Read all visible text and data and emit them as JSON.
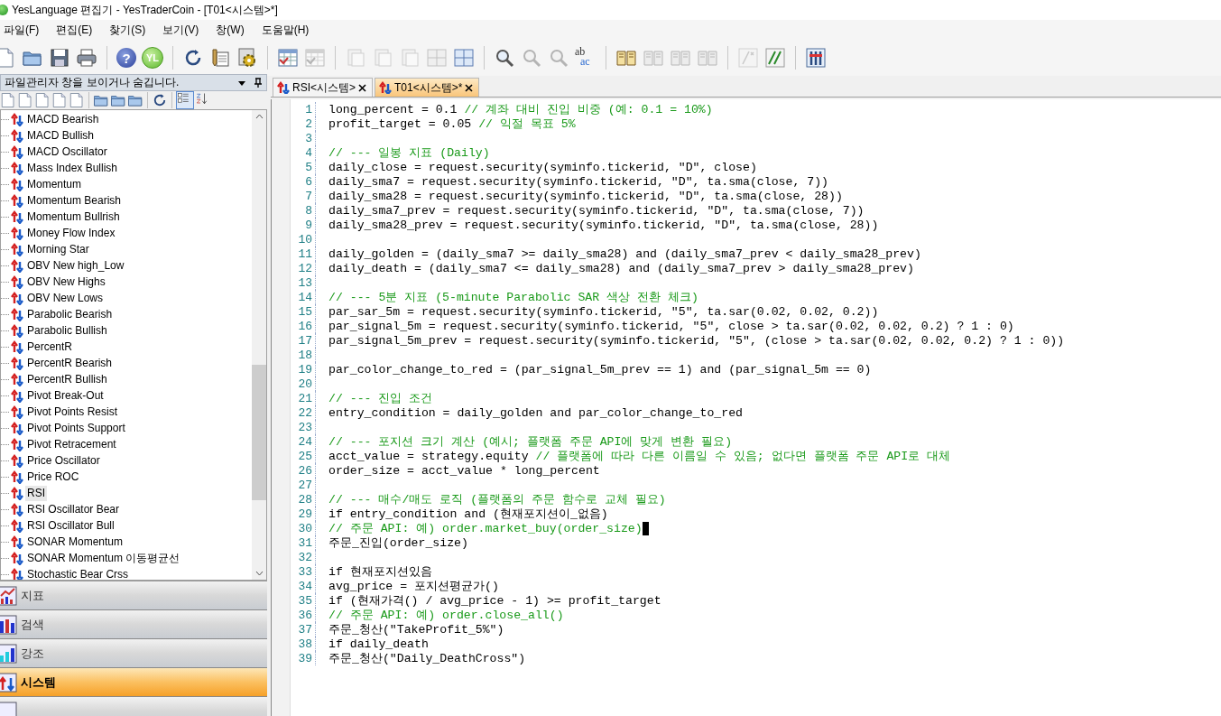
{
  "window": {
    "title": "YesLanguage 편집기 - YesTraderCoin - [T01<시스템>*]"
  },
  "menu": [
    "파일(F)",
    "편집(E)",
    "찾기(S)",
    "보기(V)",
    "창(W)",
    "도움말(H)"
  ],
  "toolbar": [
    {
      "kind": "doc",
      "disabled": false
    },
    {
      "kind": "folder",
      "disabled": false
    },
    {
      "kind": "save",
      "disabled": false
    },
    {
      "kind": "print",
      "disabled": false
    },
    {
      "kind": "sep"
    },
    {
      "kind": "help",
      "label": "?",
      "disabled": false
    },
    {
      "kind": "yl",
      "label": "YL",
      "disabled": false
    },
    {
      "kind": "sep"
    },
    {
      "kind": "refresh",
      "disabled": false
    },
    {
      "kind": "edit",
      "disabled": false
    },
    {
      "kind": "gear",
      "disabled": false
    },
    {
      "kind": "sep"
    },
    {
      "kind": "table",
      "disabled": false
    },
    {
      "kind": "table",
      "disabled": true
    },
    {
      "kind": "sep"
    },
    {
      "kind": "page",
      "disabled": true
    },
    {
      "kind": "page",
      "disabled": true
    },
    {
      "kind": "page",
      "disabled": true
    },
    {
      "kind": "grid",
      "disabled": true
    },
    {
      "kind": "grid",
      "disabled": false
    },
    {
      "kind": "sep"
    },
    {
      "kind": "magnifier",
      "disabled": false
    },
    {
      "kind": "magnifier",
      "disabled": true
    },
    {
      "kind": "magnifier",
      "disabled": true
    },
    {
      "kind": "spell",
      "label": "ab",
      "label2": "ac",
      "disabled": false
    },
    {
      "kind": "sep"
    },
    {
      "kind": "book",
      "disabled": false
    },
    {
      "kind": "book",
      "disabled": true
    },
    {
      "kind": "book",
      "disabled": true
    },
    {
      "kind": "book",
      "disabled": true
    },
    {
      "kind": "sep"
    },
    {
      "kind": "comment",
      "disabled": true
    },
    {
      "kind": "uncomment",
      "disabled": false
    },
    {
      "kind": "sep"
    },
    {
      "kind": "tools",
      "disabled": false
    }
  ],
  "file_panel": {
    "title": "파일관리자 창을 보이거나 숨깁니다.",
    "tools": [
      {
        "kind": "doc"
      },
      {
        "kind": "doc"
      },
      {
        "kind": "doc"
      },
      {
        "kind": "doc"
      },
      {
        "kind": "doc"
      },
      {
        "kind": "sep"
      },
      {
        "kind": "folder"
      },
      {
        "kind": "folder"
      },
      {
        "kind": "folder"
      },
      {
        "kind": "sep"
      },
      {
        "kind": "refresh"
      },
      {
        "kind": "sep"
      },
      {
        "kind": "list"
      },
      {
        "kind": "sort"
      }
    ],
    "items": [
      {
        "label": "MACD Bearish",
        "selected": false
      },
      {
        "label": "MACD Bullish",
        "selected": false
      },
      {
        "label": "MACD Oscillator",
        "selected": false
      },
      {
        "label": "Mass Index Bullish",
        "selected": false
      },
      {
        "label": "Momentum",
        "selected": false
      },
      {
        "label": "Momentum Bearish",
        "selected": false
      },
      {
        "label": "Momentum Bullrish",
        "selected": false
      },
      {
        "label": "Money Flow Index",
        "selected": false
      },
      {
        "label": "Morning Star",
        "selected": false
      },
      {
        "label": "OBV New high_Low",
        "selected": false
      },
      {
        "label": "OBV New Highs",
        "selected": false
      },
      {
        "label": "OBV New Lows",
        "selected": false
      },
      {
        "label": "Parabolic Bearish",
        "selected": false
      },
      {
        "label": "Parabolic Bullish",
        "selected": false
      },
      {
        "label": "PercentR",
        "selected": false
      },
      {
        "label": "PercentR Bearish",
        "selected": false
      },
      {
        "label": "PercentR Bullish",
        "selected": false
      },
      {
        "label": "Pivot Break-Out",
        "selected": false
      },
      {
        "label": "Pivot Points Resist",
        "selected": false
      },
      {
        "label": "Pivot Points Support",
        "selected": false
      },
      {
        "label": "Pivot Retracement",
        "selected": false
      },
      {
        "label": "Price Oscillator",
        "selected": false
      },
      {
        "label": "Price ROC",
        "selected": false
      },
      {
        "label": "RSI",
        "selected": true
      },
      {
        "label": "RSI Oscillator Bear",
        "selected": false
      },
      {
        "label": "RSI Oscillator Bull",
        "selected": false
      },
      {
        "label": "SONAR Momentum",
        "selected": false
      },
      {
        "label": "SONAR Momentum 이동평균선",
        "selected": false
      },
      {
        "label": "Stochastic Bear Crss",
        "selected": false
      }
    ],
    "categories": [
      {
        "label": "지표",
        "kind": "indicator",
        "selected": false
      },
      {
        "label": "검색",
        "kind": "search",
        "selected": false
      },
      {
        "label": "강조",
        "kind": "highlight",
        "selected": false
      },
      {
        "label": "시스템",
        "kind": "system",
        "selected": true
      },
      {
        "kind": "other",
        "selected": false
      }
    ]
  },
  "tabs": [
    {
      "label": "RSI<시스템>",
      "selected": false
    },
    {
      "label": "T01<시스템>*",
      "selected": true
    }
  ],
  "editor": {
    "lines": [
      {
        "number": "1",
        "code": "long_percent = 0.1 ",
        "comment": "// 계좌 대비 진입 비중 (예: 0.1 = 10%)",
        "cursor": false
      },
      {
        "number": "2",
        "code": "profit_target = 0.05 ",
        "comment": "// 익절 목표 5%",
        "cursor": false
      },
      {
        "number": "3",
        "cursor": false
      },
      {
        "number": "4",
        "comment": "// --- 일봉 지표 (Daily)",
        "cursor": false
      },
      {
        "number": "5",
        "code": "daily_close = request.security(syminfo.tickerid, \"D\", close)",
        "cursor": false
      },
      {
        "number": "6",
        "code": "daily_sma7 = request.security(syminfo.tickerid, \"D\", ta.sma(close, 7))",
        "cursor": false
      },
      {
        "number": "7",
        "code": "daily_sma28 = request.security(syminfo.tickerid, \"D\", ta.sma(close, 28))",
        "cursor": false
      },
      {
        "number": "8",
        "code": "daily_sma7_prev = request.security(syminfo.tickerid, \"D\", ta.sma(close, 7))",
        "cursor": false
      },
      {
        "number": "9",
        "code": "daily_sma28_prev = request.security(syminfo.tickerid, \"D\", ta.sma(close, 28))",
        "cursor": false
      },
      {
        "number": "10",
        "cursor": false
      },
      {
        "number": "11",
        "code": "daily_golden = (daily_sma7 >= daily_sma28) and (daily_sma7_prev < daily_sma28_prev)",
        "cursor": false
      },
      {
        "number": "12",
        "code": "daily_death = (daily_sma7 <= daily_sma28) and (daily_sma7_prev > daily_sma28_prev)",
        "cursor": false
      },
      {
        "number": "13",
        "cursor": false
      },
      {
        "number": "14",
        "comment": "// --- 5분 지표 (5-minute Parabolic SAR 색상 전환 체크)",
        "cursor": false
      },
      {
        "number": "15",
        "code": "par_sar_5m = request.security(syminfo.tickerid, \"5\", ta.sar(0.02, 0.02, 0.2))",
        "cursor": false
      },
      {
        "number": "16",
        "code": "par_signal_5m = request.security(syminfo.tickerid, \"5\", close > ta.sar(0.02, 0.02, 0.2) ? 1 : 0)",
        "cursor": false
      },
      {
        "number": "17",
        "code": "par_signal_5m_prev = request.security(syminfo.tickerid, \"5\", (close > ta.sar(0.02, 0.02, 0.2) ? 1 : 0))",
        "cursor": false
      },
      {
        "number": "18",
        "cursor": false
      },
      {
        "number": "19",
        "code": "par_color_change_to_red = (par_signal_5m_prev == 1) and (par_signal_5m == 0)",
        "cursor": false
      },
      {
        "number": "20",
        "cursor": false
      },
      {
        "number": "21",
        "comment": "// --- 진입 조건",
        "cursor": false
      },
      {
        "number": "22",
        "code": "entry_condition = daily_golden and par_color_change_to_red",
        "cursor": false
      },
      {
        "number": "23",
        "cursor": false
      },
      {
        "number": "24",
        "comment": "// --- 포지션 크기 계산 (예시; 플랫폼 주문 API에 맞게 변환 필요)",
        "cursor": false
      },
      {
        "number": "25",
        "code": "acct_value = strategy.equity ",
        "comment": "// 플랫폼에 따라 다른 이름일 수 있음; 없다면 플랫폼 주문 API로 대체",
        "cursor": false
      },
      {
        "number": "26",
        "code": "order_size = acct_value * long_percent",
        "cursor": false
      },
      {
        "number": "27",
        "cursor": false
      },
      {
        "number": "28",
        "comment": "// --- 매수/매도 로직 (플랫폼의 주문 함수로 교체 필요)",
        "cursor": false
      },
      {
        "number": "29",
        "code": "if entry_condition and (현재포지션이_없음)",
        "cursor": false
      },
      {
        "number": "30",
        "comment": "// 주문 API: 예) order.market_buy(order_size)",
        "cursor": true
      },
      {
        "number": "31",
        "code": "주문_진입(order_size)",
        "cursor": false
      },
      {
        "number": "32",
        "cursor": false
      },
      {
        "number": "33",
        "code": "if 현재포지션있음",
        "cursor": false
      },
      {
        "number": "34",
        "code": "avg_price = 포지션평균가()",
        "cursor": false
      },
      {
        "number": "35",
        "code": "if (현재가격() / avg_price - 1) >= profit_target",
        "cursor": false
      },
      {
        "number": "36",
        "comment": "// 주문 API: 예) order.close_all()",
        "cursor": false
      },
      {
        "number": "37",
        "code": "주문_청산(\"TakeProfit_5%\")",
        "cursor": false
      },
      {
        "number": "38",
        "code": "if daily_death",
        "cursor": false
      },
      {
        "number": "39",
        "code": "주문_청산(\"Daily_DeathCross\")",
        "cursor": false
      }
    ]
  }
}
